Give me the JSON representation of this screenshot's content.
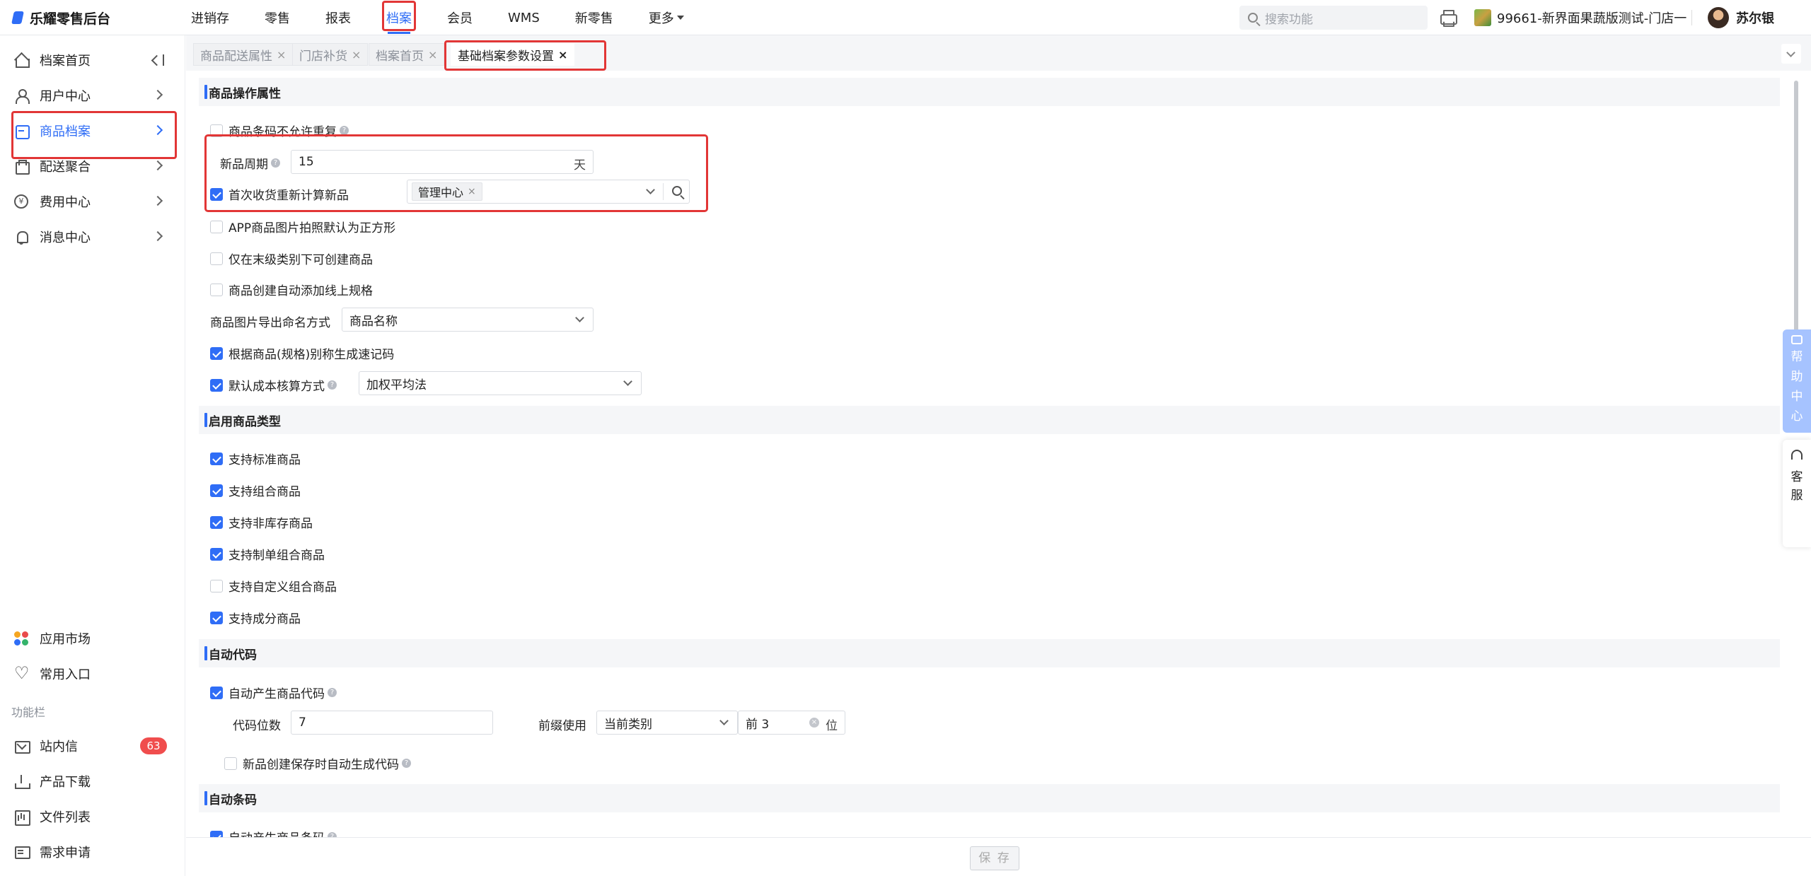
{
  "app": {
    "title": "乐耀零售后台"
  },
  "topnav": {
    "items": [
      "进销存",
      "零售",
      "报表",
      "档案",
      "会员",
      "WMS",
      "新零售",
      "更多"
    ],
    "active_index": 3
  },
  "header": {
    "search_placeholder": "搜索功能",
    "store_name": "99661-新界面果蔬版测试-门店一",
    "user_name": "苏尔银"
  },
  "sidebar": {
    "items": [
      {
        "label": "档案首页",
        "icon": "home-icon"
      },
      {
        "label": "用户中心",
        "icon": "user-icon"
      },
      {
        "label": "商品档案",
        "icon": "product-box-icon"
      },
      {
        "label": "配送聚合",
        "icon": "delivery-icon"
      },
      {
        "label": "费用中心",
        "icon": "yen-icon"
      },
      {
        "label": "消息中心",
        "icon": "bell-icon"
      }
    ],
    "bottom_items": [
      {
        "label": "应用市场",
        "icon": "app-market-icon"
      },
      {
        "label": "常用入口",
        "icon": "heart-icon"
      }
    ],
    "section_label": "功能栏",
    "function_items": [
      {
        "label": "站内信",
        "icon": "mail-icon",
        "badge": "63"
      },
      {
        "label": "产品下载",
        "icon": "download-icon"
      },
      {
        "label": "文件列表",
        "icon": "file-list-icon"
      },
      {
        "label": "需求申请",
        "icon": "request-icon"
      }
    ]
  },
  "tabs": {
    "items": [
      "商品配送属性",
      "门店补货",
      "档案首页",
      "基础档案参数设置"
    ],
    "active_index": 3,
    "close_glyph": "×"
  },
  "sections": {
    "product_ops": {
      "title": "商品操作属性",
      "barcode_unique": "商品条码不允许重复",
      "new_cycle_label": "新品周期",
      "new_cycle_value": "15",
      "new_cycle_unit": "天",
      "recalc_new_label": "首次收货重新计算新品",
      "recalc_tag": "管理中心",
      "app_photo_square": "APP商品图片拍照默认为正方形",
      "leaf_only_create": "仅在末级类别下可创建商品",
      "auto_online_spec": "商品创建自动添加线上规格",
      "image_export_label": "商品图片导出命名方式",
      "image_export_value": "商品名称",
      "quick_code_by_alias": "根据商品(规格)别称生成速记码",
      "cost_method_label": "默认成本核算方式",
      "cost_method_value": "加权平均法"
    },
    "product_types": {
      "title": "启用商品类型",
      "items": [
        {
          "label": "支持标准商品",
          "checked": true
        },
        {
          "label": "支持组合商品",
          "checked": true
        },
        {
          "label": "支持非库存商品",
          "checked": true
        },
        {
          "label": "支持制单组合商品",
          "checked": true
        },
        {
          "label": "支持自定义组合商品",
          "checked": false
        },
        {
          "label": "支持成分商品",
          "checked": true
        }
      ]
    },
    "auto_code": {
      "title": "自动代码",
      "auto_gen_label": "自动产生商品代码",
      "digits_label": "代码位数",
      "digits_value": "7",
      "prefix_label": "前缀使用",
      "prefix_value": "当前类别",
      "prefix_count": "前 3",
      "prefix_unit": "位",
      "on_save_label": "新品创建保存时自动生成代码"
    },
    "auto_barcode": {
      "title": "自动条码",
      "auto_gen_label": "自动产生商品条码"
    }
  },
  "right_float": {
    "help_center": [
      "帮",
      "助",
      "中",
      "心"
    ],
    "customer_service": [
      "客",
      "服"
    ]
  },
  "footer": {
    "save_label": "保 存"
  }
}
